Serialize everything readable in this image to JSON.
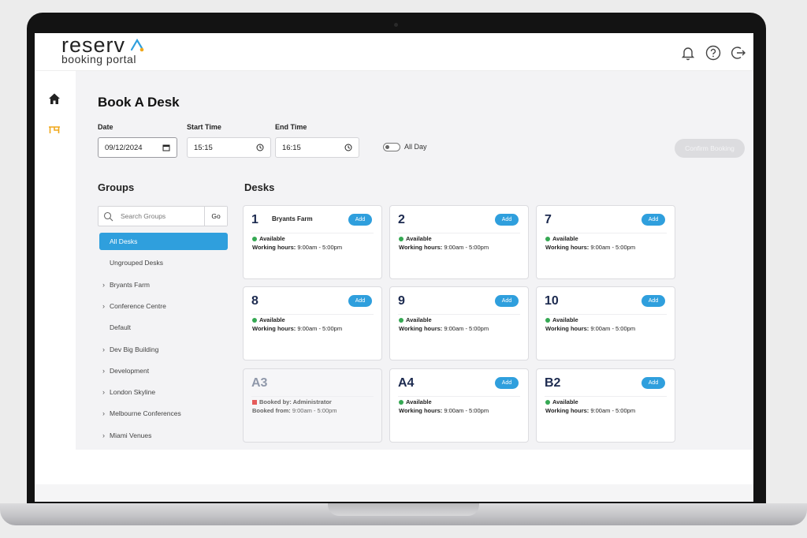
{
  "app": {
    "logo_main": "reserv",
    "logo_sub": "booking portal"
  },
  "header_icons": [
    "bell-icon",
    "help-icon",
    "logout-icon"
  ],
  "sidebar_icons": [
    "home-icon",
    "desk-icon"
  ],
  "page": {
    "title": "Book A Desk",
    "date_label": "Date",
    "date_value": "09/12/2024",
    "start_label": "Start Time",
    "start_value": "15:15",
    "end_label": "End Time",
    "end_value": "16:15",
    "allday_label": "All Day",
    "confirm_label": "Confirm Booking"
  },
  "groups": {
    "title": "Groups",
    "search_placeholder": "Search Groups",
    "go_label": "Go",
    "items": [
      {
        "label": "All Desks",
        "expandable": false,
        "active": true
      },
      {
        "label": "Ungrouped Desks",
        "expandable": false,
        "active": false
      },
      {
        "label": "Bryants Farm",
        "expandable": true,
        "active": false
      },
      {
        "label": "Conference Centre",
        "expandable": true,
        "active": false
      },
      {
        "label": "Default",
        "expandable": false,
        "active": false
      },
      {
        "label": "Dev Big Building",
        "expandable": true,
        "active": false
      },
      {
        "label": "Development",
        "expandable": true,
        "active": false
      },
      {
        "label": "London Skyline",
        "expandable": true,
        "active": false
      },
      {
        "label": "Melbourne Conferences",
        "expandable": true,
        "active": false
      },
      {
        "label": "Miami Venues",
        "expandable": true,
        "active": false
      }
    ]
  },
  "desks": {
    "title": "Desks",
    "add_label": "Add",
    "available_label": "Available",
    "hours_label": "Working hours:",
    "hours_value": "9:00am - 5:00pm",
    "items": [
      {
        "number": "1",
        "name": "Bryants Farm",
        "status": "available"
      },
      {
        "number": "2",
        "name": "",
        "status": "available"
      },
      {
        "number": "7",
        "name": "",
        "status": "available"
      },
      {
        "number": "8",
        "name": "",
        "status": "available"
      },
      {
        "number": "9",
        "name": "",
        "status": "available"
      },
      {
        "number": "10",
        "name": "",
        "status": "available"
      },
      {
        "number": "A3",
        "name": "",
        "status": "booked",
        "booked_by": "Booked by: Administrator",
        "booked_from_label": "Booked from:",
        "booked_from_value": "9:00am - 5:00pm"
      },
      {
        "number": "A4",
        "name": "",
        "status": "available"
      },
      {
        "number": "B2",
        "name": "",
        "status": "available"
      }
    ]
  },
  "colors": {
    "accent": "#2f9fdd",
    "available": "#35a853",
    "booked": "#e55b5b",
    "desk_number": "#1c2a4f",
    "logo_accent": "#2f9fdd",
    "logo_dot": "#f0a81c"
  }
}
